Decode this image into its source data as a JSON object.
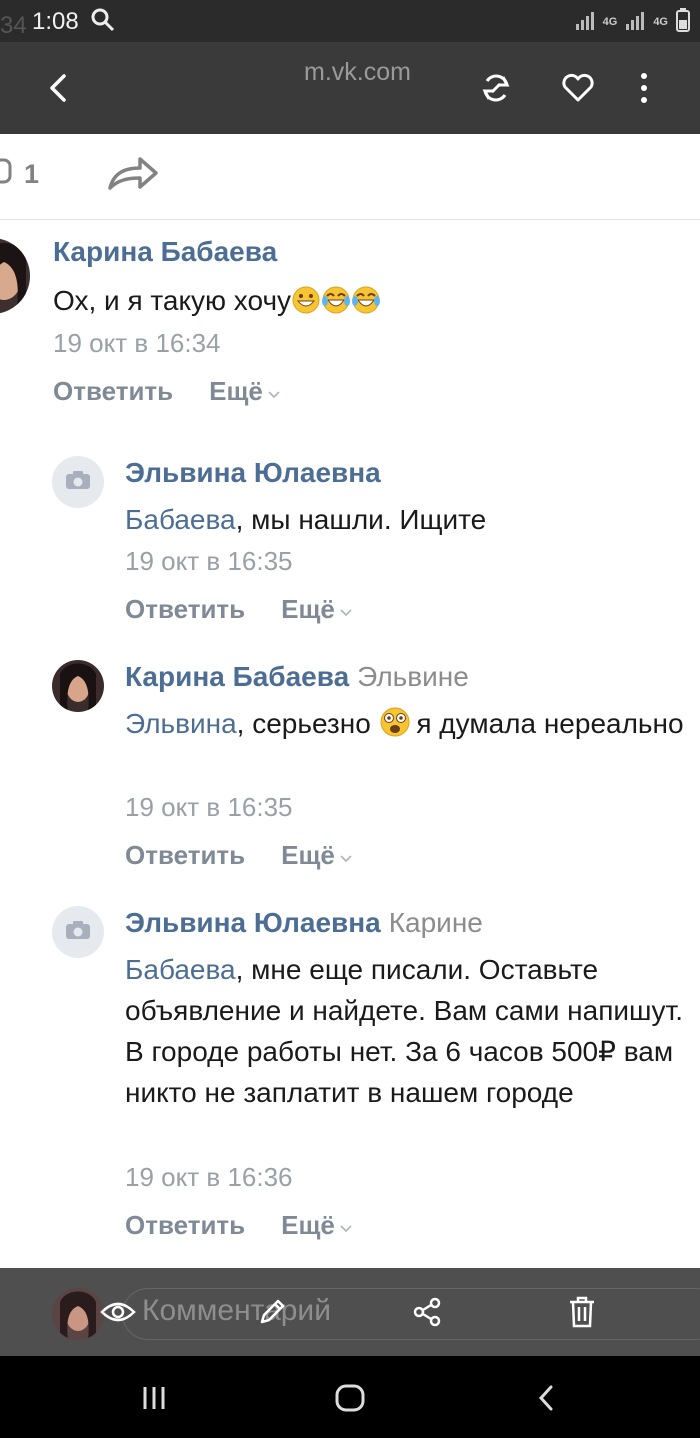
{
  "status_bar": {
    "time": "1:08",
    "ghost_text": "34",
    "network_label_1": "4G",
    "network_label_2": "4G"
  },
  "browser": {
    "url": "m.vk.com"
  },
  "post_actions": {
    "comments_count": "1"
  },
  "comments": [
    {
      "author": "Карина Бабаева",
      "reply_to": "",
      "mention": "",
      "text": "Ох, и я такую хочу",
      "date": "19 окт в 16:34",
      "reply_label": "Ответить",
      "more_label": "Ещё"
    },
    {
      "author": "Эльвина Юлаевна",
      "reply_to": "",
      "mention": "Бабаева",
      "text": ", мы нашли. Ищите",
      "date": "19 окт в 16:35",
      "reply_label": "Ответить",
      "more_label": "Ещё"
    },
    {
      "author": "Карина Бабаева",
      "reply_to": "Эльвине",
      "mention": "Эльвина",
      "text_before_emoji": ", серьезно ",
      "text_after_emoji": " я думала нереально",
      "date": "19 окт в 16:35",
      "reply_label": "Ответить",
      "more_label": "Ещё"
    },
    {
      "author": "Эльвина Юлаевна",
      "reply_to": "Карине",
      "mention": "Бабаева",
      "text": ", мне еще писали. Оставьте объявление и найдете. Вам сами напишут. В городе работы нет. За 6 часов 500₽ вам никто не заплатит в нашем городе",
      "date": "19 окт в 16:36",
      "reply_label": "Ответить",
      "more_label": "Ещё"
    }
  ],
  "comment_input": {
    "placeholder": "Комментарий"
  },
  "icons": {
    "back": "back-arrow-icon",
    "reader": "reader-mode-icon",
    "favorite": "heart-icon",
    "menu": "more-vertical-icon",
    "share": "share-arrow-icon",
    "view": "eye-icon",
    "edit": "pencil-icon",
    "share_tool": "share-nodes-icon",
    "delete": "trash-icon"
  },
  "colors": {
    "link": "#4d6e94",
    "secondary": "#9aa0a8",
    "action": "#7f8a96"
  }
}
